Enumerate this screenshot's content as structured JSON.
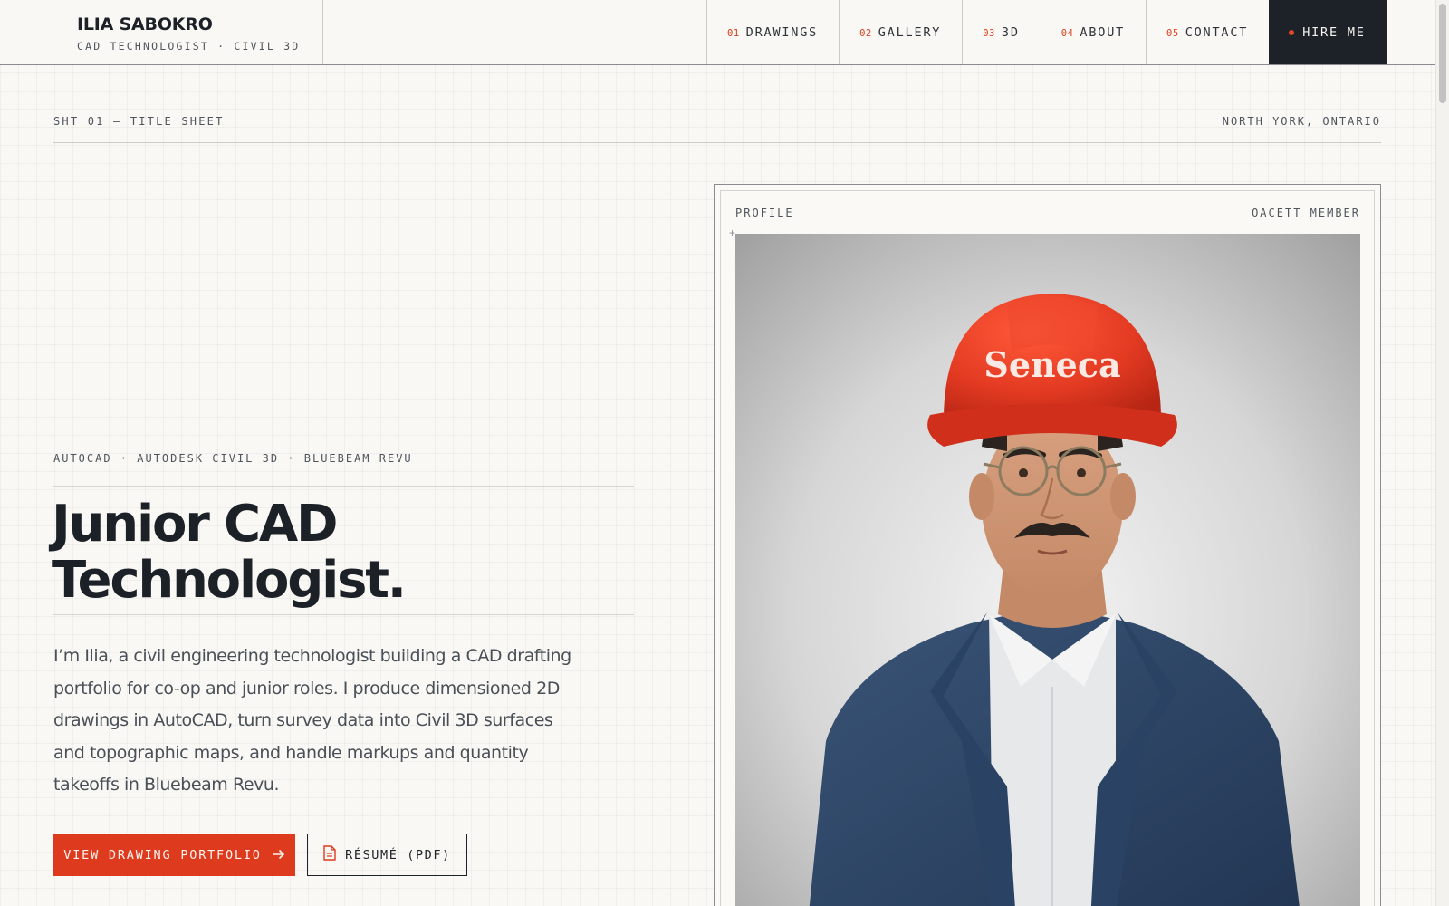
{
  "brand": {
    "name": "ILIA SABOKRO",
    "subtitle": "CAD TECHNOLOGIST · CIVIL 3D"
  },
  "nav": {
    "items": [
      {
        "num": "01",
        "label": "DRAWINGS"
      },
      {
        "num": "02",
        "label": "GALLERY"
      },
      {
        "num": "03",
        "label": "3D"
      },
      {
        "num": "04",
        "label": "ABOUT"
      },
      {
        "num": "05",
        "label": "CONTACT"
      }
    ],
    "hire_label": "HIRE ME"
  },
  "sheet": {
    "label": "SHT 01 — TITLE SHEET",
    "location": "NORTH YORK, ONTARIO"
  },
  "hero": {
    "tools": "AUTOCAD · AUTODESK CIVIL 3D · BLUEBEAM REVU",
    "headline_line1": "Junior CAD",
    "headline_line2": "Technologist.",
    "intro": "I’m Ilia, a civil engineering technologist building a CAD drafting portfolio for co-op and junior roles. I produce dimensioned 2D drawings in AutoCAD, turn survey data into Civil 3D surfaces and topographic maps, and handle markups and quantity takeoffs in Bluebeam Revu.",
    "primary_cta": "VIEW DRAWING PORTFOLIO",
    "secondary_cta": "RÉSUMÉ (PDF)"
  },
  "profile": {
    "label": "PROFILE",
    "badge": "OACETT MEMBER",
    "helmet_text": "Seneca"
  },
  "colors": {
    "accent": "#de3a1e",
    "dark": "#1d2128",
    "paper": "#f9f8f4",
    "helmet": "#e33a22",
    "suit": "#2f4868"
  },
  "icons": {
    "cta_arrow": "arrow-right-icon",
    "resume": "document-icon",
    "hire": "status-dot-icon"
  }
}
